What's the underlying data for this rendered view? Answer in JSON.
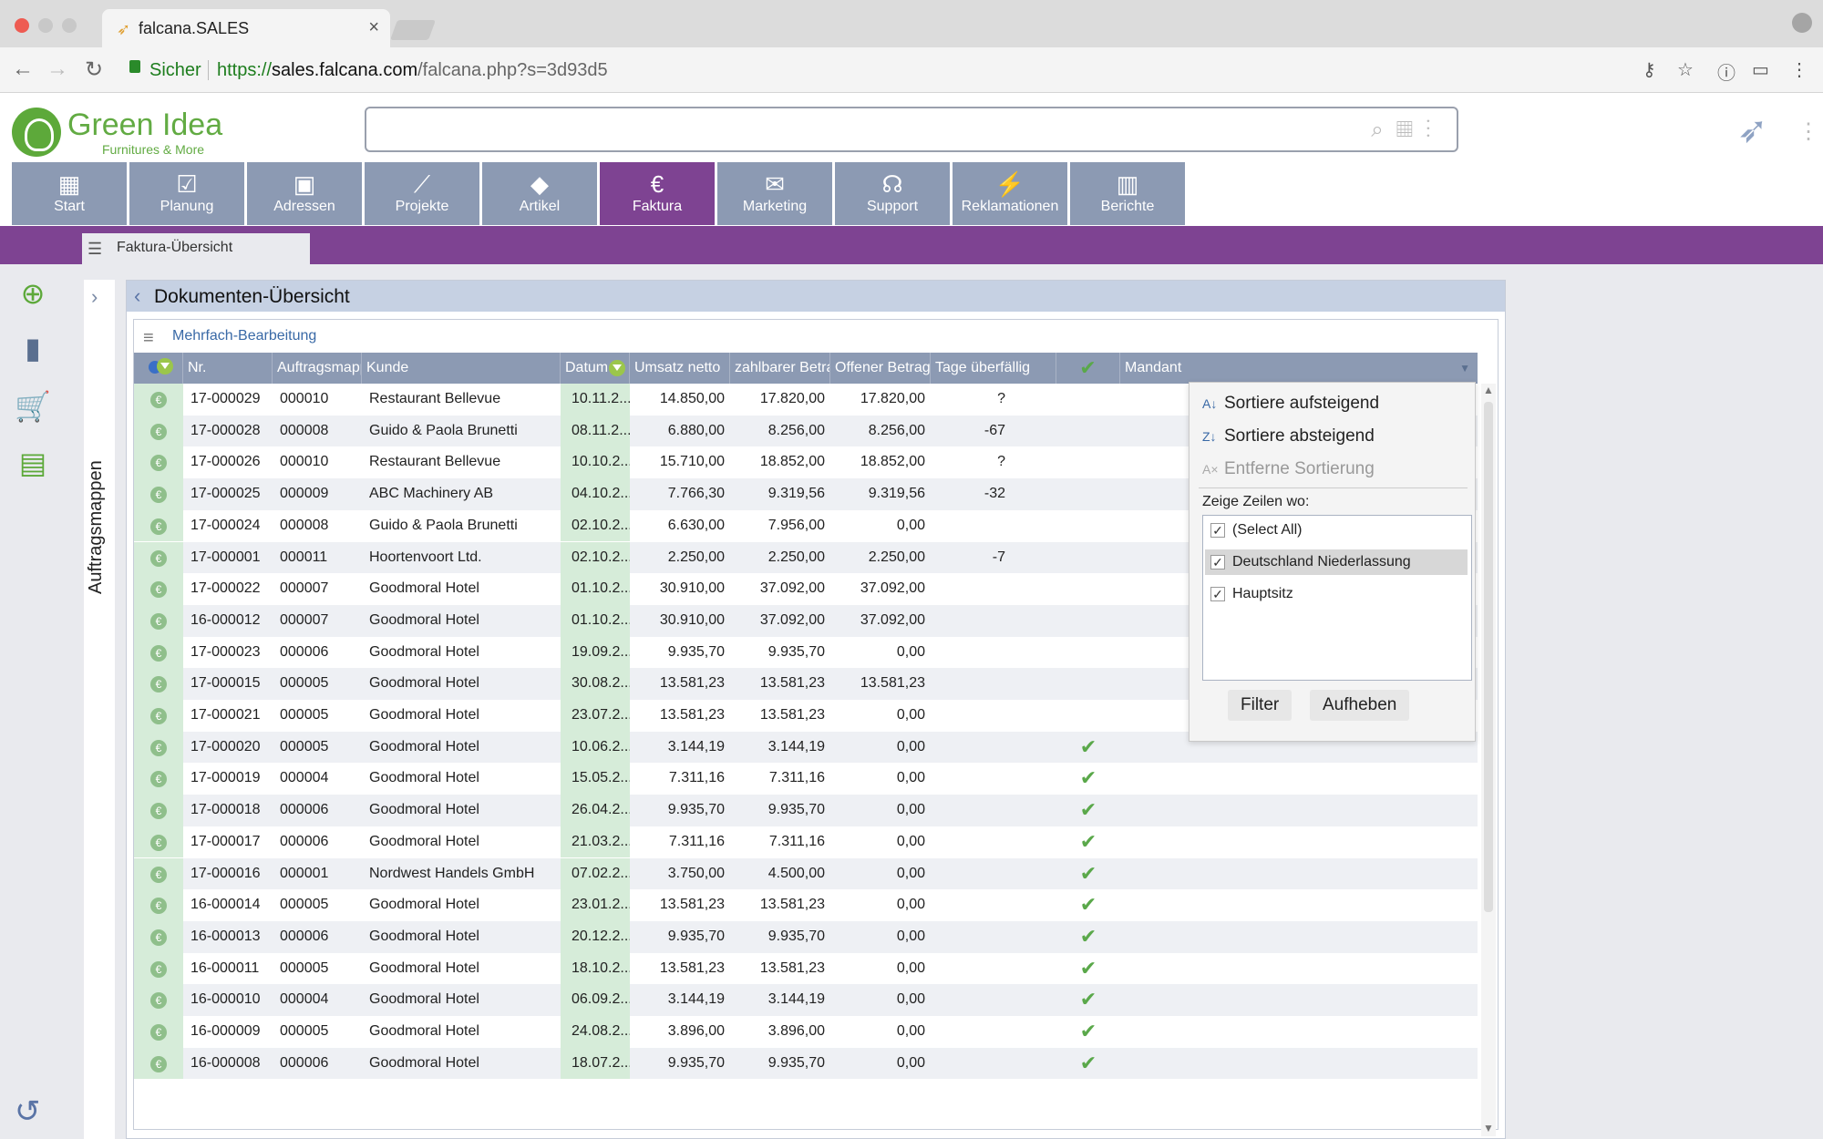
{
  "browser": {
    "tab_title": "falcana.SALES",
    "secure_label": "Sicher",
    "url_protocol": "https://",
    "url_host": "sales.falcana.com",
    "url_path": "/falcana.php?s=3d93d5"
  },
  "brand": {
    "name": "Green Idea",
    "tagline": "Furnitures & More",
    "accent": "#7e4392",
    "nav_color": "#8c9ab3",
    "logo_green": "#62ab43"
  },
  "modules": [
    {
      "label": "Start",
      "icon": "grid-icon"
    },
    {
      "label": "Planung",
      "icon": "clipboard-icon"
    },
    {
      "label": "Adressen",
      "icon": "address-book-icon"
    },
    {
      "label": "Projekte",
      "icon": "chart-line-icon"
    },
    {
      "label": "Artikel",
      "icon": "shapes-icon"
    },
    {
      "label": "Faktura",
      "icon": "euro-icon"
    },
    {
      "label": "Marketing",
      "icon": "mail-icon"
    },
    {
      "label": "Support",
      "icon": "headset-icon"
    },
    {
      "label": "Reklamationen",
      "icon": "broken-link-icon"
    },
    {
      "label": "Berichte",
      "icon": "bar-chart-icon"
    }
  ],
  "active_module": "Faktura",
  "subtab": {
    "label": "Faktura-Übersicht"
  },
  "folders": {
    "label": "Auftragsmappen"
  },
  "panel": {
    "title": "Dokumenten-Übersicht",
    "multi_edit": "Mehrfach-Bearbeitung"
  },
  "table": {
    "columns": [
      "Nr.",
      "Auftragsmappe",
      "Kunde",
      "Datum",
      "Umsatz netto",
      "zahlbarer Betrag",
      "Offener Betrag",
      "Tage überfällig",
      "",
      "Mandant"
    ],
    "rows": [
      {
        "nr": "17-000029",
        "mappe": "000010",
        "kunde": "Restaurant Bellevue",
        "datum": "10.11.2...",
        "umsatz": "14.850,00",
        "zahlbar": "17.820,00",
        "offen": "17.820,00",
        "tage": "?",
        "check": false
      },
      {
        "nr": "17-000028",
        "mappe": "000008",
        "kunde": "Guido & Paola Brunetti",
        "datum": "08.11.2...",
        "umsatz": "6.880,00",
        "zahlbar": "8.256,00",
        "offen": "8.256,00",
        "tage": "-67",
        "check": false
      },
      {
        "nr": "17-000026",
        "mappe": "000010",
        "kunde": "Restaurant Bellevue",
        "datum": "10.10.2...",
        "umsatz": "15.710,00",
        "zahlbar": "18.852,00",
        "offen": "18.852,00",
        "tage": "?",
        "check": false
      },
      {
        "nr": "17-000025",
        "mappe": "000009",
        "kunde": "ABC Machinery AB",
        "datum": "04.10.2...",
        "umsatz": "7.766,30",
        "zahlbar": "9.319,56",
        "offen": "9.319,56",
        "tage": "-32",
        "check": false
      },
      {
        "nr": "17-000024",
        "mappe": "000008",
        "kunde": "Guido & Paola Brunetti",
        "datum": "02.10.2...",
        "umsatz": "6.630,00",
        "zahlbar": "7.956,00",
        "offen": "0,00",
        "tage": "",
        "check": false
      },
      {
        "nr": "17-000001",
        "mappe": "000011",
        "kunde": "Hoortenvoort Ltd.",
        "datum": "02.10.2...",
        "umsatz": "2.250,00",
        "zahlbar": "2.250,00",
        "offen": "2.250,00",
        "tage": "-7",
        "check": false
      },
      {
        "nr": "17-000022",
        "mappe": "000007",
        "kunde": "Goodmoral Hotel",
        "datum": "01.10.2...",
        "umsatz": "30.910,00",
        "zahlbar": "37.092,00",
        "offen": "37.092,00",
        "tage": "",
        "check": false
      },
      {
        "nr": "16-000012",
        "mappe": "000007",
        "kunde": "Goodmoral Hotel",
        "datum": "01.10.2...",
        "umsatz": "30.910,00",
        "zahlbar": "37.092,00",
        "offen": "37.092,00",
        "tage": "",
        "check": false
      },
      {
        "nr": "17-000023",
        "mappe": "000006",
        "kunde": "Goodmoral Hotel",
        "datum": "19.09.2...",
        "umsatz": "9.935,70",
        "zahlbar": "9.935,70",
        "offen": "0,00",
        "tage": "",
        "check": false
      },
      {
        "nr": "17-000015",
        "mappe": "000005",
        "kunde": "Goodmoral Hotel",
        "datum": "30.08.2...",
        "umsatz": "13.581,23",
        "zahlbar": "13.581,23",
        "offen": "13.581,23",
        "tage": "",
        "check": false
      },
      {
        "nr": "17-000021",
        "mappe": "000005",
        "kunde": "Goodmoral Hotel",
        "datum": "23.07.2...",
        "umsatz": "13.581,23",
        "zahlbar": "13.581,23",
        "offen": "0,00",
        "tage": "",
        "check": false
      },
      {
        "nr": "17-000020",
        "mappe": "000005",
        "kunde": "Goodmoral Hotel",
        "datum": "10.06.2...",
        "umsatz": "3.144,19",
        "zahlbar": "3.144,19",
        "offen": "0,00",
        "tage": "",
        "check": true
      },
      {
        "nr": "17-000019",
        "mappe": "000004",
        "kunde": "Goodmoral Hotel",
        "datum": "15.05.2...",
        "umsatz": "7.311,16",
        "zahlbar": "7.311,16",
        "offen": "0,00",
        "tage": "",
        "check": true
      },
      {
        "nr": "17-000018",
        "mappe": "000006",
        "kunde": "Goodmoral Hotel",
        "datum": "26.04.2...",
        "umsatz": "9.935,70",
        "zahlbar": "9.935,70",
        "offen": "0,00",
        "tage": "",
        "check": true
      },
      {
        "nr": "17-000017",
        "mappe": "000006",
        "kunde": "Goodmoral Hotel",
        "datum": "21.03.2...",
        "umsatz": "7.311,16",
        "zahlbar": "7.311,16",
        "offen": "0,00",
        "tage": "",
        "check": true
      },
      {
        "nr": "17-000016",
        "mappe": "000001",
        "kunde": "Nordwest Handels GmbH",
        "datum": "07.02.2...",
        "umsatz": "3.750,00",
        "zahlbar": "4.500,00",
        "offen": "0,00",
        "tage": "",
        "check": true
      },
      {
        "nr": "16-000014",
        "mappe": "000005",
        "kunde": "Goodmoral Hotel",
        "datum": "23.01.2...",
        "umsatz": "13.581,23",
        "zahlbar": "13.581,23",
        "offen": "0,00",
        "tage": "",
        "check": true
      },
      {
        "nr": "16-000013",
        "mappe": "000006",
        "kunde": "Goodmoral Hotel",
        "datum": "20.12.2...",
        "umsatz": "9.935,70",
        "zahlbar": "9.935,70",
        "offen": "0,00",
        "tage": "",
        "check": true
      },
      {
        "nr": "16-000011",
        "mappe": "000005",
        "kunde": "Goodmoral Hotel",
        "datum": "18.10.2...",
        "umsatz": "13.581,23",
        "zahlbar": "13.581,23",
        "offen": "0,00",
        "tage": "",
        "check": true
      },
      {
        "nr": "16-000010",
        "mappe": "000004",
        "kunde": "Goodmoral Hotel",
        "datum": "06.09.2...",
        "umsatz": "3.144,19",
        "zahlbar": "3.144,19",
        "offen": "0,00",
        "tage": "",
        "check": true
      },
      {
        "nr": "16-000009",
        "mappe": "000005",
        "kunde": "Goodmoral Hotel",
        "datum": "24.08.2...",
        "umsatz": "3.896,00",
        "zahlbar": "3.896,00",
        "offen": "0,00",
        "tage": "",
        "check": true
      },
      {
        "nr": "16-000008",
        "mappe": "000006",
        "kunde": "Goodmoral Hotel",
        "datum": "18.07.2...",
        "umsatz": "9.935,70",
        "zahlbar": "9.935,70",
        "offen": "0,00",
        "tage": "",
        "check": true
      }
    ]
  },
  "filter_popup": {
    "sort_asc": "Sortiere aufsteigend",
    "sort_desc": "Sortiere absteigend",
    "sort_remove": "Entferne Sortierung",
    "where_label": "Zeige Zeilen wo:",
    "options": [
      {
        "label": "(Select All)",
        "checked": true,
        "selected": false
      },
      {
        "label": "Deutschland Niederlassung",
        "checked": true,
        "selected": true
      },
      {
        "label": "Hauptsitz",
        "checked": true,
        "selected": false
      }
    ],
    "filter_button": "Filter",
    "clear_button": "Aufheben"
  }
}
